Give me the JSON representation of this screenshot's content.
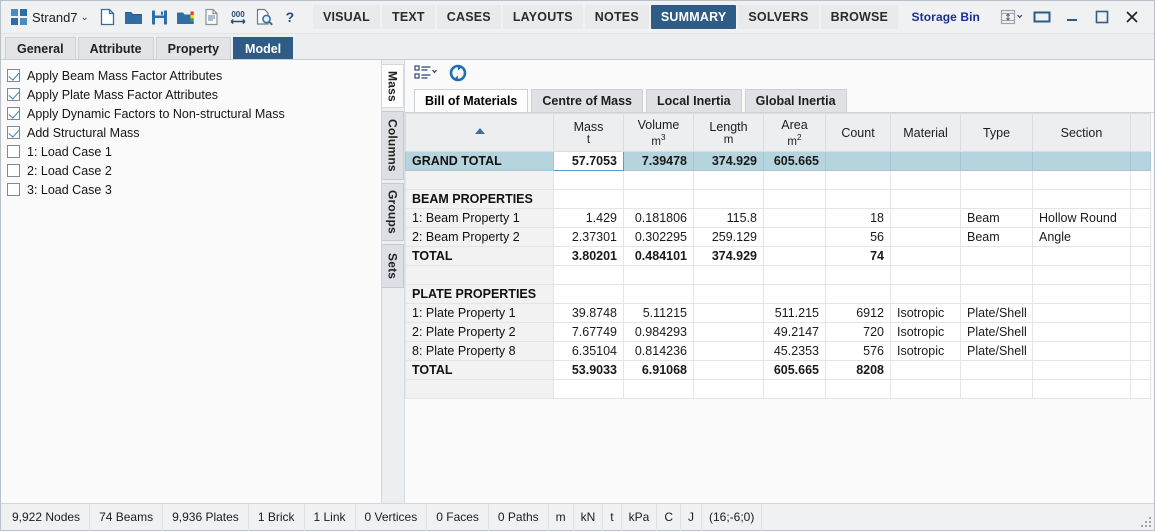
{
  "titlebar": {
    "app_name": "Strand7",
    "dropdown_caret": "⌄",
    "tools": [
      {
        "name": "new-file-icon",
        "label": "New"
      },
      {
        "name": "open-folder-icon",
        "label": "Open"
      },
      {
        "name": "save-icon",
        "label": "Save"
      },
      {
        "name": "results-folder-icon",
        "label": "Open Results"
      },
      {
        "name": "report-icon",
        "label": "Report"
      },
      {
        "name": "scale-000-icon",
        "label": "Scale"
      },
      {
        "name": "preview-icon",
        "label": "Preview"
      },
      {
        "name": "help-icon",
        "label": "?"
      }
    ],
    "ribbon_tabs": [
      {
        "label": "VISUAL",
        "active": false
      },
      {
        "label": "TEXT",
        "active": false
      },
      {
        "label": "CASES",
        "active": false
      },
      {
        "label": "LAYOUTS",
        "active": false
      },
      {
        "label": "NOTES",
        "active": false
      },
      {
        "label": "SUMMARY",
        "active": true
      },
      {
        "label": "SOLVERS",
        "active": false
      },
      {
        "label": "BROWSE",
        "active": false
      }
    ],
    "storage_bin": "Storage Bin",
    "window_buttons": [
      {
        "name": "dock-split-icon",
        "label": "Dock"
      },
      {
        "name": "restore-icon",
        "label": "Restore"
      },
      {
        "name": "minimize-icon",
        "label": "Minimize"
      },
      {
        "name": "maximize-icon",
        "label": "Maximize"
      },
      {
        "name": "close-icon",
        "label": "Close"
      }
    ]
  },
  "subtabs": [
    {
      "label": "General",
      "active": false
    },
    {
      "label": "Attribute",
      "active": false
    },
    {
      "label": "Property",
      "active": false
    },
    {
      "label": "Model",
      "active": true
    }
  ],
  "left_panel": {
    "options": [
      {
        "label": "Apply Beam Mass Factor Attributes",
        "checked": true
      },
      {
        "label": "Apply Plate Mass Factor Attributes",
        "checked": true
      },
      {
        "label": "Apply Dynamic Factors to Non-structural Mass",
        "checked": true
      },
      {
        "label": "Add Structural Mass",
        "checked": true
      },
      {
        "label": "1: Load Case 1",
        "checked": false
      },
      {
        "label": "2: Load Case 2",
        "checked": false
      },
      {
        "label": "3: Load Case 3",
        "checked": false
      }
    ]
  },
  "vertical_tabs": [
    {
      "label": "Mass",
      "active": true
    },
    {
      "label": "Columns",
      "active": false
    },
    {
      "label": "Groups",
      "active": false
    },
    {
      "label": "Sets",
      "active": false
    }
  ],
  "mini_toolbar": [
    {
      "name": "list-options-icon",
      "label": "List Options"
    },
    {
      "name": "refresh-icon",
      "label": "Refresh"
    }
  ],
  "data_tabs": [
    {
      "label": "Bill of Materials",
      "active": true
    },
    {
      "label": "Centre of Mass",
      "active": false
    },
    {
      "label": "Local Inertia",
      "active": false
    },
    {
      "label": "Global Inertia",
      "active": false
    }
  ],
  "table": {
    "columns": [
      {
        "title": "",
        "unit": "",
        "sorted": true
      },
      {
        "title": "Mass",
        "unit": "t",
        "selected": true
      },
      {
        "title": "Volume",
        "unit": "m",
        "sup": "3"
      },
      {
        "title": "Length",
        "unit": "m"
      },
      {
        "title": "Area",
        "unit": "m",
        "sup": "2"
      },
      {
        "title": "Count",
        "unit": ""
      },
      {
        "title": "Material",
        "unit": ""
      },
      {
        "title": "Type",
        "unit": ""
      },
      {
        "title": "Section",
        "unit": ""
      }
    ],
    "rows": [
      {
        "kind": "grand",
        "cells": [
          "GRAND TOTAL",
          "57.7053",
          "7.39478",
          "374.929",
          "605.665",
          "",
          "",
          "",
          ""
        ]
      },
      {
        "kind": "blank",
        "cells": [
          "",
          "",
          "",
          "",
          "",
          "",
          "",
          "",
          ""
        ]
      },
      {
        "kind": "head",
        "cells": [
          "BEAM PROPERTIES",
          "",
          "",
          "",
          "",
          "",
          "",
          "",
          ""
        ]
      },
      {
        "kind": "data",
        "cells": [
          "1: Beam Property 1",
          "1.429",
          "0.181806",
          "115.8",
          "",
          "18",
          "",
          "Beam",
          "Hollow Round"
        ]
      },
      {
        "kind": "data",
        "cells": [
          "2: Beam Property 2",
          "2.37301",
          "0.302295",
          "259.129",
          "",
          "56",
          "",
          "Beam",
          "Angle"
        ]
      },
      {
        "kind": "total",
        "cells": [
          "TOTAL",
          "3.80201",
          "0.484101",
          "374.929",
          "",
          "74",
          "",
          "",
          ""
        ]
      },
      {
        "kind": "blank",
        "cells": [
          "",
          "",
          "",
          "",
          "",
          "",
          "",
          "",
          ""
        ]
      },
      {
        "kind": "head",
        "cells": [
          "PLATE PROPERTIES",
          "",
          "",
          "",
          "",
          "",
          "",
          "",
          ""
        ]
      },
      {
        "kind": "data",
        "cells": [
          "1: Plate Property 1",
          "39.8748",
          "5.11215",
          "",
          "511.215",
          "6912",
          "Isotropic",
          "Plate/Shell",
          ""
        ]
      },
      {
        "kind": "data",
        "cells": [
          "2: Plate Property 2",
          "7.67749",
          "0.984293",
          "",
          "49.2147",
          "720",
          "Isotropic",
          "Plate/Shell",
          ""
        ]
      },
      {
        "kind": "data",
        "cells": [
          "8: Plate Property 8",
          "6.35104",
          "0.814236",
          "",
          "45.2353",
          "576",
          "Isotropic",
          "Plate/Shell",
          ""
        ]
      },
      {
        "kind": "total",
        "cells": [
          "TOTAL",
          "53.9033",
          "6.91068",
          "",
          "605.665",
          "8208",
          "",
          "",
          ""
        ]
      },
      {
        "kind": "blank",
        "cells": [
          "",
          "",
          "",
          "",
          "",
          "",
          "",
          "",
          ""
        ]
      }
    ]
  },
  "statusbar": {
    "cells": [
      "9,922 Nodes",
      "74 Beams",
      "9,936 Plates",
      "1 Brick",
      "1 Link",
      "0 Vertices",
      "0 Faces",
      "0 Paths",
      "m",
      "kN",
      "t",
      "kPa",
      "C",
      "J",
      "(16;-6;0)"
    ]
  },
  "colors": {
    "accent": "#2f5c86",
    "selected_header": "#b6d4dd",
    "storage_bin": "#1a2f8f"
  }
}
